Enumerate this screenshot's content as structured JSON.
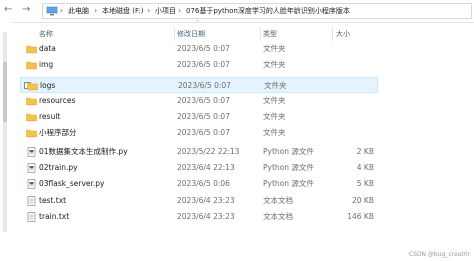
{
  "address_bar": {
    "back": "←",
    "forward": "→",
    "crumbs": [
      "此电脑",
      "本地磁盘 (F:)",
      "小项目",
      "076基于python深度学习的人脸年龄识别小程序版本"
    ]
  },
  "columns": {
    "name": "名称",
    "date": "修改日期",
    "type": "类型",
    "size": "大小"
  },
  "files": [
    {
      "name": "data",
      "date": "2023/6/5 0:07",
      "type": "文件夹",
      "size": "",
      "icon": "folder-icon"
    },
    {
      "name": "img",
      "date": "2023/6/5 0:07",
      "type": "文件夹",
      "size": "",
      "icon": "folder-icon"
    },
    {
      "name": "logs",
      "date": "2023/6/5 0:07",
      "type": "文件夹",
      "size": "",
      "icon": "folder-icon"
    },
    {
      "name": "resources",
      "date": "2023/6/5 0:07",
      "type": "文件夹",
      "size": "",
      "icon": "folder-icon"
    },
    {
      "name": "result",
      "date": "2023/6/5 0:07",
      "type": "文件夹",
      "size": "",
      "icon": "folder-icon"
    },
    {
      "name": "小程序部分",
      "date": "2023/6/5 0:07",
      "type": "文件夹",
      "size": "",
      "icon": "folder-icon"
    },
    {
      "name": "01数据集文本生成制作.py",
      "date": "2023/5/22 22:13",
      "type": "Python 源文件",
      "size": "2 KB",
      "icon": "python-file-icon"
    },
    {
      "name": "02train.py",
      "date": "2023/6/4 22:13",
      "type": "Python 源文件",
      "size": "4 KB",
      "icon": "python-file-icon"
    },
    {
      "name": "03flask_server.py",
      "date": "2023/6/5 0:06",
      "type": "Python 源文件",
      "size": "5 KB",
      "icon": "python-file-icon"
    },
    {
      "name": "test.txt",
      "date": "2023/6/4 23:23",
      "type": "文本文档",
      "size": "20 KB",
      "icon": "text-file-icon"
    },
    {
      "name": "train.txt",
      "date": "2023/6/4 23:23",
      "type": "文本文档",
      "size": "146 KB",
      "icon": "text-file-icon"
    }
  ],
  "selected_index": 2,
  "watermark": "CSDN @bug_creat0r",
  "colors": {
    "folder": "#f3c24e",
    "selection": "#e5f3ff",
    "header_text": "#4c607a"
  }
}
